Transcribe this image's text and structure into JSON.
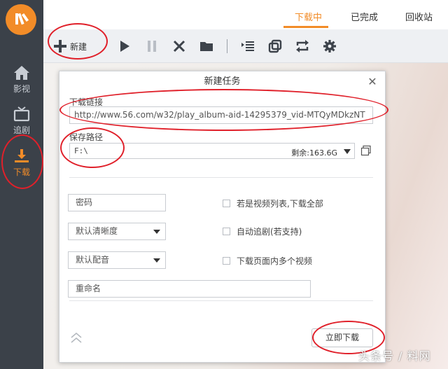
{
  "sidebar": {
    "logo_icon": "brand-logo-icon",
    "items": [
      {
        "label": "影视",
        "icon": "home-icon"
      },
      {
        "label": "追剧",
        "icon": "tv-icon"
      },
      {
        "label": "下载",
        "icon": "download-icon"
      }
    ]
  },
  "tabs": [
    {
      "label": "下载中",
      "active": true
    },
    {
      "label": "已完成",
      "active": false
    },
    {
      "label": "回收站",
      "active": false
    }
  ],
  "toolbar": {
    "new_label": "新建",
    "icons": [
      "plus-icon",
      "play-icon",
      "pause-icon",
      "delete-icon",
      "folder-icon",
      "list-icon",
      "copy-icon",
      "refresh-icon",
      "settings-icon"
    ]
  },
  "dialog": {
    "title": "新建任务",
    "url_label": "下载链接",
    "url_value": "http://www.56.com/w32/play_album-aid-14295379_vid-MTQyMDkzNT",
    "path_label": "保存路径",
    "path_value": "F:\\",
    "path_free": "剩余:163.6G",
    "password_placeholder": "密码",
    "quality_value": "默认清晰度",
    "dub_value": "默认配音",
    "rename_placeholder": "重命名",
    "checks": [
      {
        "label": "若是视频列表,下载全部"
      },
      {
        "label": "自动追剧(若支持)"
      },
      {
        "label": "下载页面内多个视频"
      }
    ],
    "download_now": "立即下载"
  },
  "watermark": "头条号 / 料网",
  "colors": {
    "accent": "#f28c28",
    "sidebar": "#3b4149",
    "annotation": "#e0202a"
  }
}
